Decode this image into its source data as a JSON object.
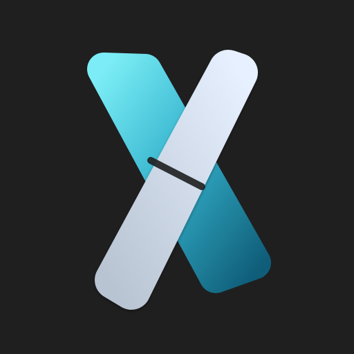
{
  "app": {
    "background_color": "#1f1f20"
  },
  "logo": {
    "icon": "x-logo-icon",
    "colors": {
      "cyan_top": "#7ef2fb",
      "cyan_mid": "#38b9d2",
      "teal_bottom": "#0f5f7b",
      "silver_top": "#e6f0ff",
      "silver_bottom": "#b9c4d2"
    }
  }
}
